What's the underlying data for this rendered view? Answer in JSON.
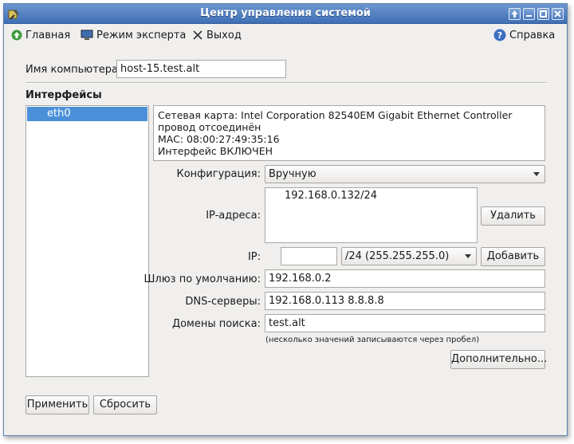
{
  "window": {
    "title": "Центр управления системой"
  },
  "toolbar": {
    "home_label": "Главная",
    "expert_label": "Режим эксперта",
    "exit_label": "Выход",
    "help_label": "Справка"
  },
  "computer_name": {
    "label": "Имя компьютера:",
    "value": "host-15.test.alt"
  },
  "interfaces": {
    "title": "Интерфейсы",
    "items": [
      "eth0"
    ]
  },
  "info": {
    "line1": "Сетевая карта: Intel Corporation 82540EM Gigabit Ethernet Controller",
    "line2": "провод отсоединён",
    "line3": "MAC: 08:00:27:49:35:16",
    "line4": "Интерфейс ВКЛЮЧЕН"
  },
  "config": {
    "label": "Конфигурация:",
    "value": "Вручную"
  },
  "ip_addresses": {
    "label": "IP-адреса:",
    "items": [
      "192.168.0.132/24"
    ],
    "delete_label": "Удалить",
    "ip_label": "IP:",
    "ip_value": "",
    "mask_value": "/24 (255.255.255.0)",
    "add_label": "Добавить"
  },
  "gateway": {
    "label": "Шлюз по умолчанию:",
    "value": "192.168.0.2"
  },
  "dns": {
    "label": "DNS-серверы:",
    "value": "192.168.0.113 8.8.8.8"
  },
  "search_domains": {
    "label": "Домены поиска:",
    "value": "test.alt",
    "hint": "(несколько значений записываются через пробел)"
  },
  "buttons": {
    "more_label": "Дополнительно...",
    "apply_label": "Применить",
    "reset_label": "Сбросить"
  },
  "colors": {
    "selection": "#4a90d9",
    "titlebar": "#4f7fc0"
  }
}
